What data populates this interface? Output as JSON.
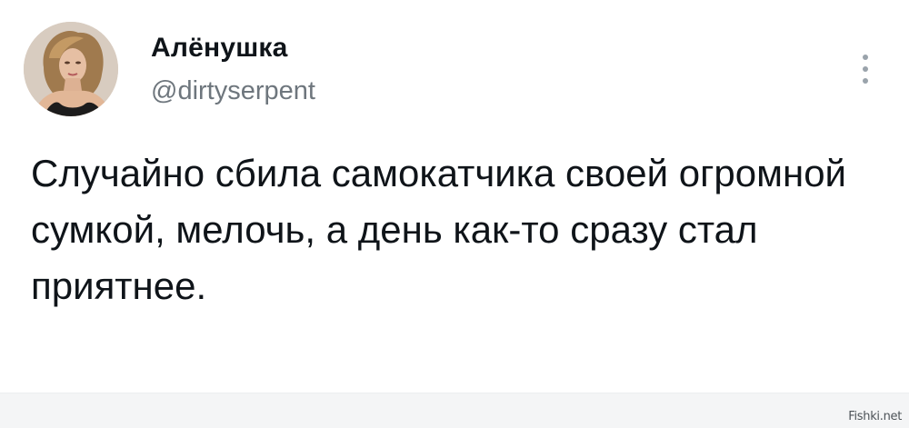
{
  "tweet": {
    "author": {
      "display_name": "Алёнушка",
      "handle": "@dirtyserpent",
      "avatar_icon": "user-avatar-photo"
    },
    "more_icon": "vertical-ellipsis-icon",
    "text": "Случайно сбила самокатчика своей огромной сумкой, мелочь, а день как-то сразу стал приятнее."
  },
  "watermark": {
    "text": "Fishki.net"
  },
  "colors": {
    "background": "#ffffff",
    "text": "#0f1419",
    "secondary_text": "#6e767d",
    "footer_strip": "#f4f5f6"
  }
}
